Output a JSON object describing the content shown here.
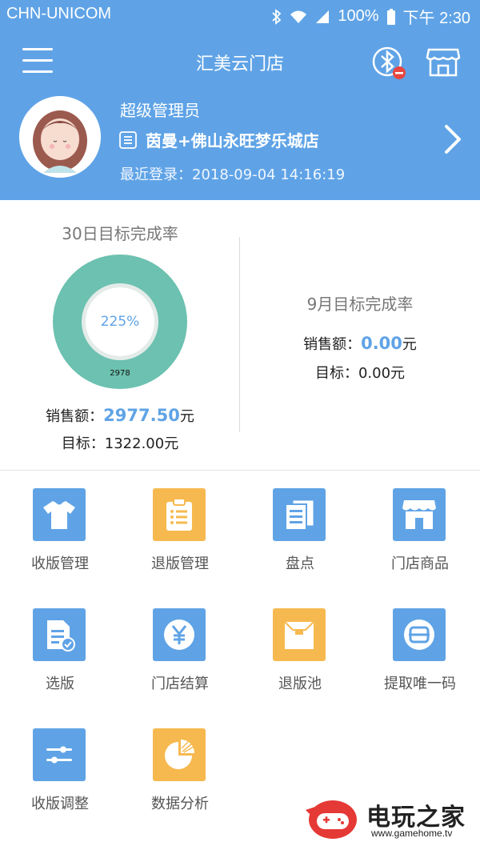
{
  "status_bar": {
    "carrier": "CHN-UNICOM",
    "battery": "100%",
    "time": "下午 2:30"
  },
  "navbar": {
    "title": "汇美云门店",
    "icons": [
      "menu-icon",
      "bluetooth-icon",
      "store-icon"
    ]
  },
  "profile": {
    "role": "超级管理员",
    "store": "茵曼+佛山永旺梦乐城店",
    "last_login": "最近登录：2018-09-04 14:16:19"
  },
  "stats": {
    "left": {
      "title": "30日目标完成率",
      "percent": "225%",
      "donut_value": "2978",
      "sales_label": "销售额：",
      "sales_value": "2977.50",
      "sales_unit": "元",
      "target": "目标：1322.00元"
    },
    "right": {
      "title": "9月目标完成率",
      "sales_label": "销售额：",
      "sales_value": "0.00",
      "sales_unit": "元",
      "target": "目标：0.00元"
    }
  },
  "colors": {
    "header": "#5fa3e6",
    "donut": "#6cc1b0",
    "tile_blue": "#5fa3e6",
    "tile_orange": "#f6b94f"
  },
  "menu": [
    {
      "label": "收版管理",
      "icon": "shirt-icon"
    },
    {
      "label": "退版管理",
      "icon": "clipboard-icon"
    },
    {
      "label": "盘点",
      "icon": "documents-icon"
    },
    {
      "label": "门店商品",
      "icon": "shop-icon"
    },
    {
      "label": "选版",
      "icon": "doc-check-icon"
    },
    {
      "label": "门店结算",
      "icon": "yen-icon"
    },
    {
      "label": "退版池",
      "icon": "box-icon"
    },
    {
      "label": "提取唯一码",
      "icon": "scan-icon"
    },
    {
      "label": "收版调整",
      "icon": "sliders-icon"
    },
    {
      "label": "数据分析",
      "icon": "pie-chart-icon"
    }
  ],
  "watermark": {
    "text": "电玩之家",
    "url": "www.gamehome.tv"
  }
}
